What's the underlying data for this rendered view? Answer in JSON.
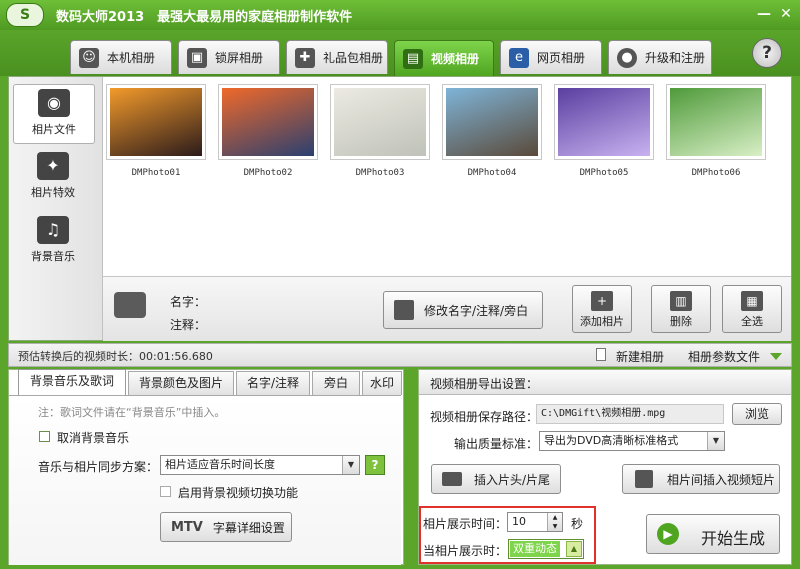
{
  "app": {
    "logo": "S",
    "title": "数码大师2013　最强大最易用的家庭相册制作软件",
    "minimize": "—",
    "close": "✕",
    "help": "?"
  },
  "tabs": [
    {
      "label": "本机相册",
      "icon": "person-icon",
      "glyph": "☺"
    },
    {
      "label": "锁屏相册",
      "icon": "monitor-icon",
      "glyph": "▣"
    },
    {
      "label": "礼品包相册",
      "icon": "gift-icon",
      "glyph": "✚"
    },
    {
      "label": "视频相册",
      "icon": "film-icon",
      "glyph": "▤",
      "active": true
    },
    {
      "label": "网页相册",
      "icon": "ie-icon",
      "glyph": "e"
    },
    {
      "label": "升级和注册",
      "icon": "globe-icon",
      "glyph": "●"
    }
  ],
  "sidebar": [
    {
      "label": "相片文件",
      "icon": "camera-icon",
      "glyph": "◉",
      "active": true
    },
    {
      "label": "相片特效",
      "icon": "effects-icon",
      "glyph": "✦"
    },
    {
      "label": "背景音乐",
      "icon": "music-icon",
      "glyph": "♫"
    }
  ],
  "photos": [
    {
      "caption": "DMPhoto01",
      "colors": [
        "#f39a2b",
        "#2b1b1b"
      ]
    },
    {
      "caption": "DMPhoto02",
      "colors": [
        "#f0692a",
        "#2a4070"
      ]
    },
    {
      "caption": "DMPhoto03",
      "colors": [
        "#eceae2",
        "#bfc2b8"
      ]
    },
    {
      "caption": "DMPhoto04",
      "colors": [
        "#7fb4d8",
        "#5a4a3a"
      ]
    },
    {
      "caption": "DMPhoto05",
      "colors": [
        "#5a3fa0",
        "#c8b2f0"
      ]
    },
    {
      "caption": "DMPhoto06",
      "colors": [
        "#4f9a3a",
        "#d8efc6"
      ]
    }
  ],
  "details": {
    "name_label": "名字：",
    "comment_label": "注释：",
    "edit_button": "修改名字/注释/旁白",
    "add_button": "添加相片",
    "delete_button": "删除",
    "select_all_button": "全选"
  },
  "info": {
    "estimate": "预估转换后的视频时长：00:01:56.680",
    "new_album": "新建相册",
    "album_params": "相册参数文件"
  },
  "left_tabs": [
    "背景音乐及歌词",
    "背景颜色及图片",
    "名字/注释",
    "旁白",
    "水印"
  ],
  "music": {
    "note": "注：歌词文件请在“背景音乐”中插入。",
    "cancel_music": "取消背景音乐",
    "sync_label": "音乐与相片同步方案：",
    "sync_value": "相片适应音乐时间长度",
    "video_switch": "启用背景视频切换功能",
    "mtv_icon": "MTV",
    "mtv_button": "字幕详细设置"
  },
  "export": {
    "header": "视频相册导出设置：",
    "path_label": "视频相册保存路径：",
    "path_value": "C:\\DMGift\\视频相册.mpg",
    "browse": "浏览",
    "quality_label": "输出质量标准：",
    "quality_value": "导出为DVD高清晰标准格式",
    "insert_head": "插入片头/片尾",
    "insert_clip": "相片间插入视频短片",
    "display_time_label": "相片展示时间：",
    "display_time_value": "10",
    "unit": "秒",
    "display_mode_label": "当相片展示时：",
    "display_mode_value": "双重动态",
    "start": "开始生成"
  },
  "colors": {
    "accent": "#5aa52a",
    "highlight": "#e0312a"
  }
}
